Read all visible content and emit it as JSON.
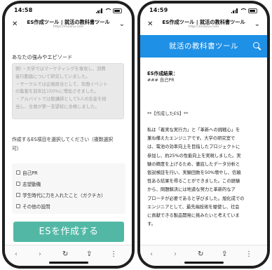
{
  "status": {
    "left_time": "14:58",
    "right_time": "14:59"
  },
  "browser": {
    "title": "ES作成ツール | 就活の教科書ツール",
    "url": "https://reashu.com",
    "close_icon": "close-icon",
    "toolbar_icons": [
      "back-icon",
      "forward-icon",
      "reload-icon",
      "share-icon",
      "more-icon"
    ]
  },
  "left": {
    "episode_label": "あなたの強みやエピソード",
    "episode_placeholder": [
      "例）・大学ではマーケティングを専攻し、消費",
      "者行動論について研究していました。",
      "・サークルでは企画担当として、年間イベント",
      "の集客を前年比150%に増加させました。",
      "・アルバイトでは塾講師として5人の生徒を担",
      "当し、全員が第一志望校に合格しました。"
    ],
    "select_label": [
      "作成するES項目を選択してください（複数選択",
      "可）"
    ],
    "options": [
      "自己PR",
      "志望動機",
      "学生時代に力を入れたこと（ガクチカ）",
      "その他の設問"
    ],
    "create_button": "ESを作成する"
  },
  "right": {
    "brand": "就活の教科書ツール",
    "result_heading": "ES作成結果：",
    "result_sub": "### 自己PR",
    "section_title": "**【作成したES】**",
    "body": [
      "私は「着実な実行力」と「革新への挑戦心」を",
      "兼ね備えたエンジニアです。大学の研究室で",
      "は、電池の効率向上を目指したプロジェクトに",
      "参加し、約25%の性能向上を実現しました。実",
      "験の精度を上げるため、徹底したデータ分析と",
      "仮説検証を行い、実験回数を50%増やし、信頼",
      "性ある結果を得ることができました。この経験",
      "から、問題解決には地道な努力と革新的なア",
      "プローチが必要であると学びました。旭化成での",
      "エンジニアとして、最先端技術を駆使し、社会",
      "に貢献できる製品開発に挑みたいと考えていま",
      "す。"
    ]
  }
}
